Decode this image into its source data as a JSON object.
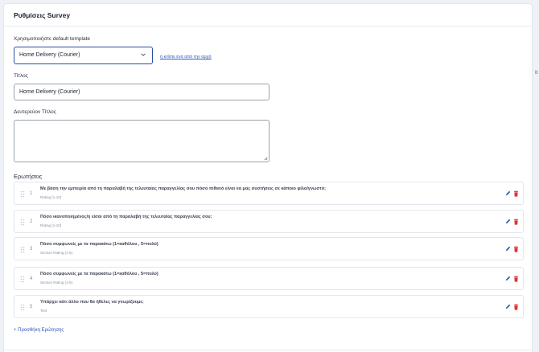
{
  "card": {
    "title": "Ρυθμίσεις Survey"
  },
  "template": {
    "label": "Χρησιμοποιήστε default template",
    "selected": "Home Delivery (Courier)",
    "create_link": "ή κτίστε ένα από την αρχή"
  },
  "title_field": {
    "label": "Τίτλος",
    "value": "Home Delivery (Courier)"
  },
  "subtitle_field": {
    "label": "Δευτερεύον Τίτλος",
    "value": ""
  },
  "questions": {
    "label": "Ερωτήσεις",
    "items": [
      {
        "num": "1",
        "title": "Με βάση την εμπειρία από τη παραλαβή της τελευταίας παραγγελίας σου πόσο πιθανό είναι να μας συστήσεις σε κάποιο φίλο/γνωστό;",
        "type": "Rating (1-10)"
      },
      {
        "num": "2",
        "title": "Πόσο ικανοποιημένος/η είσαι από τη παραλαβή της τελευταίας παραγγελίας σου;",
        "type": "Rating (1-10)"
      },
      {
        "num": "3",
        "title": "Πόσο συμφωνείς με τα παρακάτω (1=καθόλου , 5=πολύ)",
        "type": "Section Rating (1-5)"
      },
      {
        "num": "4",
        "title": "Πόσο συμφωνείς με τα παρακάτω (1=καθόλου , 5=πολύ)",
        "type": "Section Rating (1-5)"
      },
      {
        "num": "5",
        "title": "Υπάρχει κάτι άλλο που θα ήθελες να γνωρίζουμε;",
        "type": "Text"
      }
    ],
    "add_label": "+ Προσθήκη Ερώτησης"
  },
  "side_fragment": "It",
  "colors": {
    "accent": "#2d55b5",
    "delete": "#e0302f",
    "border": "#e3e6ec"
  },
  "icons": {
    "drag": "drag-handle-icon",
    "edit": "pencil-icon",
    "delete": "trash-icon",
    "dropdown": "chevron-down-icon"
  }
}
